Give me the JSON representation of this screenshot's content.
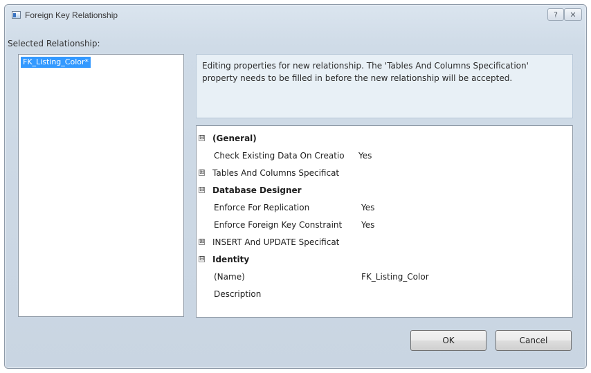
{
  "window": {
    "title": "Foreign Key Relationship",
    "help_label": "?",
    "close_label": "✕"
  },
  "selected_relationship": {
    "label": "Selected Relationship:",
    "items": [
      {
        "label": "FK_Listing_Color*",
        "selected": true
      }
    ]
  },
  "info_text": "Editing properties for new relationship.  The 'Tables And Columns Specification' property needs to be filled in before the new relationship will be accepted.",
  "properties": {
    "general": {
      "label": "(General)",
      "expander": "⊟",
      "check_existing": {
        "name": "Check Existing Data On Creatio",
        "value": "Yes"
      },
      "tables_columns": {
        "name": "Tables And Columns Specificat",
        "expander": "⊞",
        "value": ""
      }
    },
    "database_designer": {
      "label": "Database Designer",
      "expander": "⊟",
      "enforce_replication": {
        "name": "Enforce For Replication",
        "value": "Yes"
      },
      "enforce_fk": {
        "name": "Enforce Foreign Key Constraint",
        "value": "Yes"
      },
      "insert_update": {
        "name": "INSERT And UPDATE Specificat",
        "expander": "⊞",
        "value": ""
      }
    },
    "identity": {
      "label": "Identity",
      "expander": "⊟",
      "name": {
        "name": "(Name)",
        "value": "FK_Listing_Color"
      },
      "description": {
        "name": "Description",
        "value": ""
      }
    }
  },
  "buttons": {
    "ok": "OK",
    "cancel": "Cancel"
  },
  "colors": {
    "selection": "#3399ff",
    "info_background": "#e8f0f6",
    "window_background": "#cfdbe7"
  }
}
